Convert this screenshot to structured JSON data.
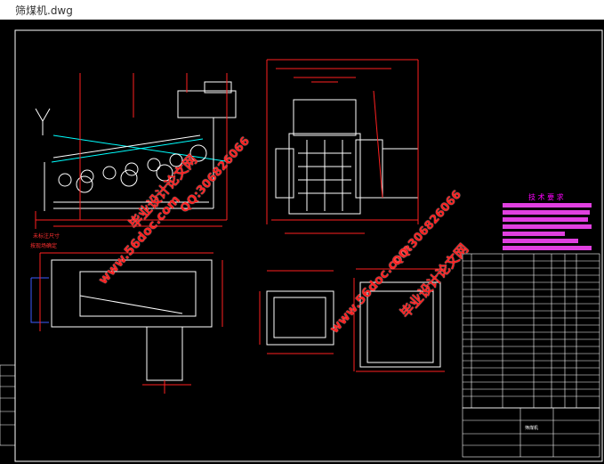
{
  "window": {
    "title": "筛煤机.dwg"
  },
  "watermarks": {
    "left_site": "毕业设计论文网",
    "left_qq": "QQ:306826066",
    "left_url": "www.56doc.com",
    "right_url": "www.56doc.com",
    "right_qq": "QQ:306826066",
    "right_site": "毕业设计论文网"
  },
  "tech_requirements": {
    "title": "技 术 要 求"
  },
  "notes": {
    "line1": "未标注尺寸",
    "line2": "按现场确定"
  },
  "title_block": {
    "row1": "筛煤机",
    "row2": ""
  },
  "colors": {
    "background": "#000000",
    "outline": "#ffffff",
    "dimension": "#ff2020",
    "section": "#3b5bff",
    "text_magenta": "#ff00ff",
    "hatch_cyan": "#00ffff",
    "green": "#00ff00"
  }
}
